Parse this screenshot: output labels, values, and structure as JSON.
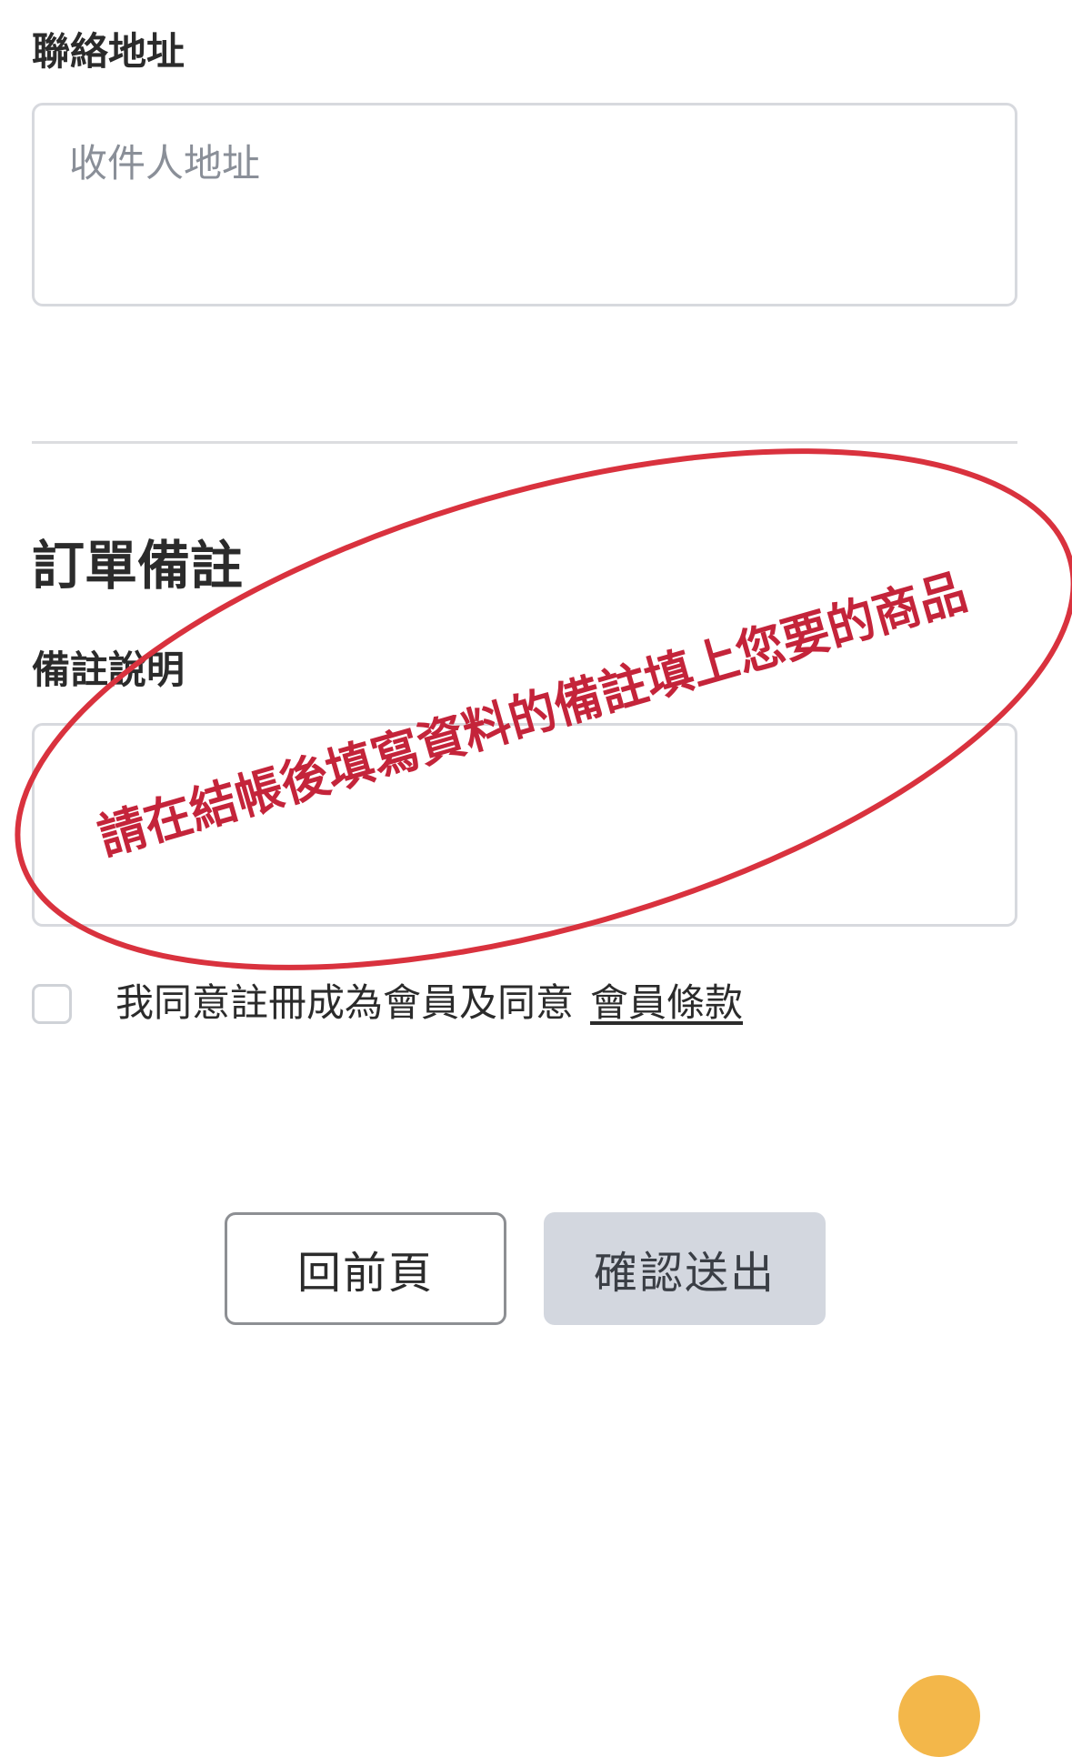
{
  "contact_address": {
    "label": "聯絡地址",
    "placeholder": "收件人地址"
  },
  "order_notes": {
    "section_title": "訂單備註",
    "note_label": "備註說明",
    "note_placeholder": ""
  },
  "agreement": {
    "text": "我同意註冊成為會員及同意",
    "link": "會員條款"
  },
  "buttons": {
    "back": "回前頁",
    "submit": "確認送出"
  },
  "annotation": {
    "text": "請在結帳後填寫資料的備註填上您要的商品",
    "color": "#c4243a"
  },
  "colors": {
    "border": "#d7d9de",
    "submit_bg": "#d3d7df",
    "placeholder": "#8a8f98",
    "fab": "#f3b74a"
  }
}
